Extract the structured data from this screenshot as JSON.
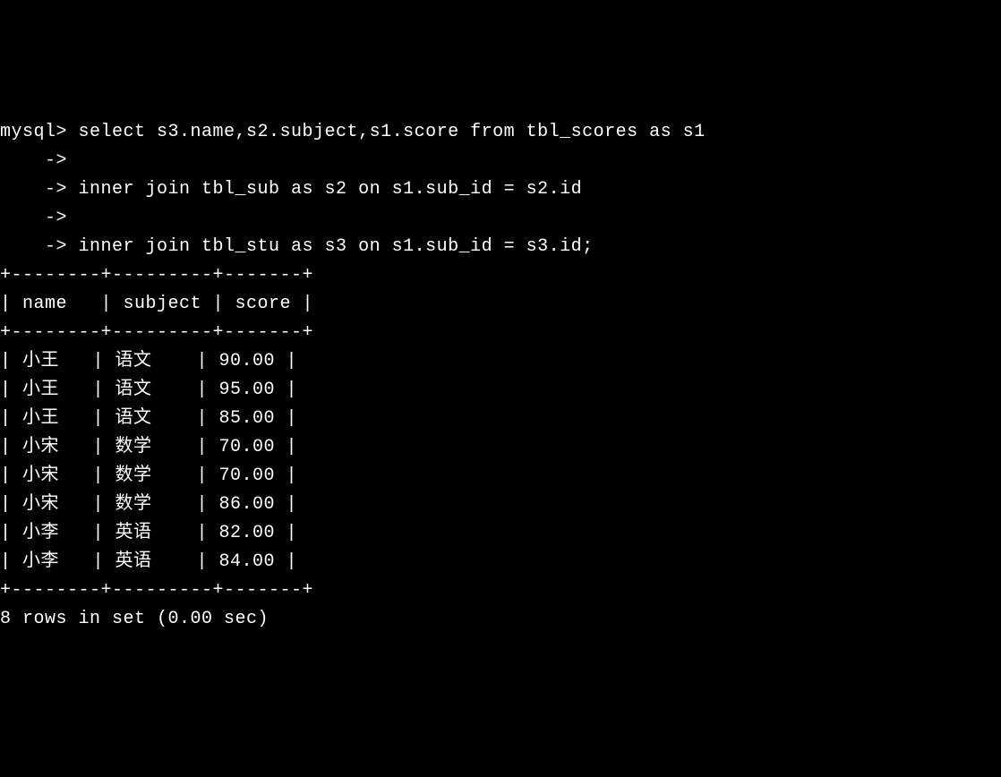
{
  "terminal": {
    "prompt": "mysql>",
    "continuation": "    ->",
    "query_lines": [
      "mysql> select s3.name,s2.subject,s1.score from tbl_scores as s1",
      "    ->",
      "    -> inner join tbl_sub as s2 on s1.sub_id = s2.id",
      "    ->",
      "    -> inner join tbl_stu as s3 on s1.sub_id = s3.id;"
    ],
    "table": {
      "border_top": "+--------+---------+-------+",
      "header_row": "| name   | subject | score |",
      "border_mid": "+--------+---------+-------+",
      "columns": [
        "name",
        "subject",
        "score"
      ],
      "rows": [
        {
          "name": "小王",
          "subject": "语文",
          "score": "90.00"
        },
        {
          "name": "小王",
          "subject": "语文",
          "score": "95.00"
        },
        {
          "name": "小王",
          "subject": "语文",
          "score": "85.00"
        },
        {
          "name": "小宋",
          "subject": "数学",
          "score": "70.00"
        },
        {
          "name": "小宋",
          "subject": "数学",
          "score": "70.00"
        },
        {
          "name": "小宋",
          "subject": "数学",
          "score": "86.00"
        },
        {
          "name": "小李",
          "subject": "英语",
          "score": "82.00"
        },
        {
          "name": "小李",
          "subject": "英语",
          "score": "84.00"
        }
      ],
      "border_bottom": "+--------+---------+-------+"
    },
    "status": "8 rows in set (0.00 sec)"
  }
}
